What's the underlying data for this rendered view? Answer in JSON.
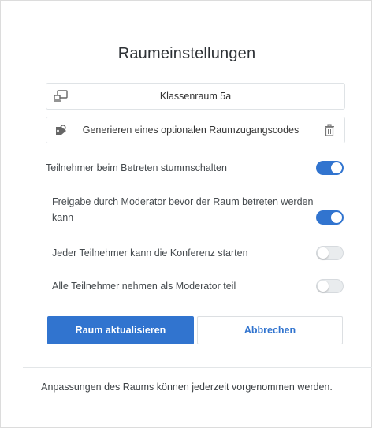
{
  "dialog": {
    "title": "Raumeinstellungen",
    "room_name": {
      "value": "Klassenraum 5a",
      "icon": "room-icon"
    },
    "access_code": {
      "label": "Generieren eines optionalen Raumzugangscodes",
      "icon": "key-code-icon",
      "delete_icon": "trash-icon"
    },
    "settings": [
      {
        "label": "Teilnehmer beim Betreten stummschalten",
        "enabled": true
      },
      {
        "label": "Freigabe durch Moderator bevor der Raum betreten werden kann",
        "enabled": true
      },
      {
        "label": "Jeder Teilnehmer kann die Konferenz starten",
        "enabled": false
      },
      {
        "label": "Alle Teilnehmer nehmen als Moderator teil",
        "enabled": false
      }
    ],
    "buttons": {
      "update": "Raum aktualisieren",
      "cancel": "Abbrechen"
    },
    "footer": "Anpassungen des Raums können jederzeit vorgenommen werden."
  },
  "colors": {
    "accent": "#3174cf",
    "toggle_off": "#e9ecee"
  }
}
